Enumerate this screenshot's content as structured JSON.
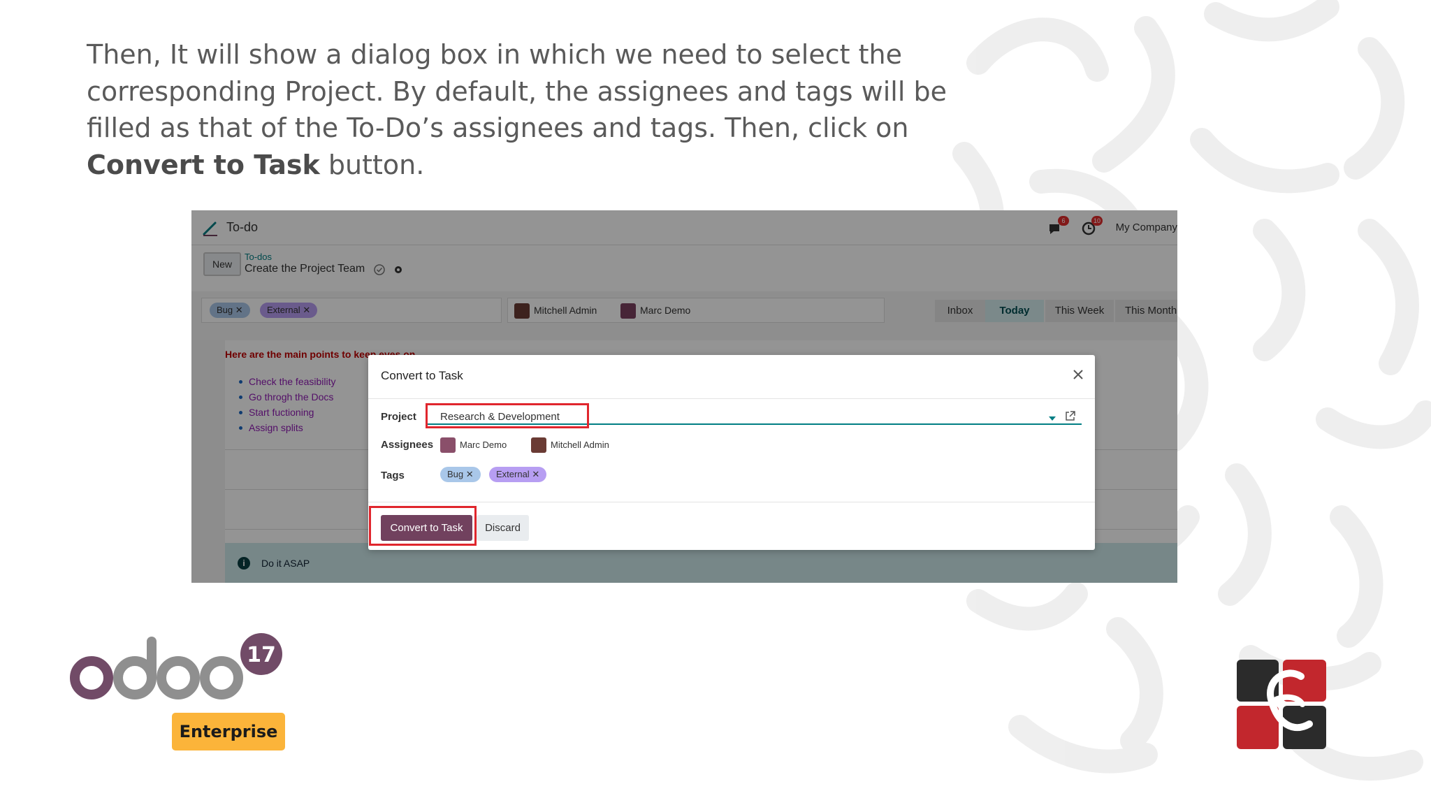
{
  "slide": {
    "text_plain_1": "Then, It will show a dialog box in which we need to select the corresponding Project. By default, the assignees and tags will be filled as that of the To-Do’s assignees and tags. Then, click on ",
    "text_bold_1": "Convert to Task",
    "text_plain_2": "  button.",
    "logo_version": "17",
    "logo_edition": "Enterprise"
  },
  "app": {
    "title": "To-do",
    "chat_badge": "6",
    "activity_badge": "10",
    "company": "My Company"
  },
  "control_panel": {
    "new_label": "New",
    "breadcrumb_parent": "To-dos",
    "breadcrumb_current": "Create the Project Team"
  },
  "record": {
    "tags": [
      "Bug",
      "External"
    ],
    "assignees": [
      "Mitchell Admin",
      "Marc Demo"
    ],
    "stages": [
      "Inbox",
      "Today",
      "This Week",
      "This Month"
    ],
    "active_stage": "Today",
    "heading": "Here are the main points to keep eyes on",
    "points": [
      "Check the feasibility",
      "Go throgh the Docs",
      "Start fuctioning",
      "Assign splits"
    ],
    "alert": "Do it ASAP"
  },
  "dialog": {
    "title": "Convert to Task",
    "project_label": "Project",
    "project_value": "Research & Development",
    "assignees_label": "Assignees",
    "assignees": [
      "Marc Demo",
      "Mitchell Admin"
    ],
    "tags_label": "Tags",
    "tags": [
      "Bug",
      "External"
    ],
    "convert_label": "Convert to Task",
    "discard_label": "Discard"
  },
  "colors": {
    "odoo_purple": "#714B67",
    "odoo_gray": "#8F8F8F",
    "enterprise_yellow": "#FBB43A",
    "highlight_red": "#E0262D",
    "teal": "#017E84"
  }
}
